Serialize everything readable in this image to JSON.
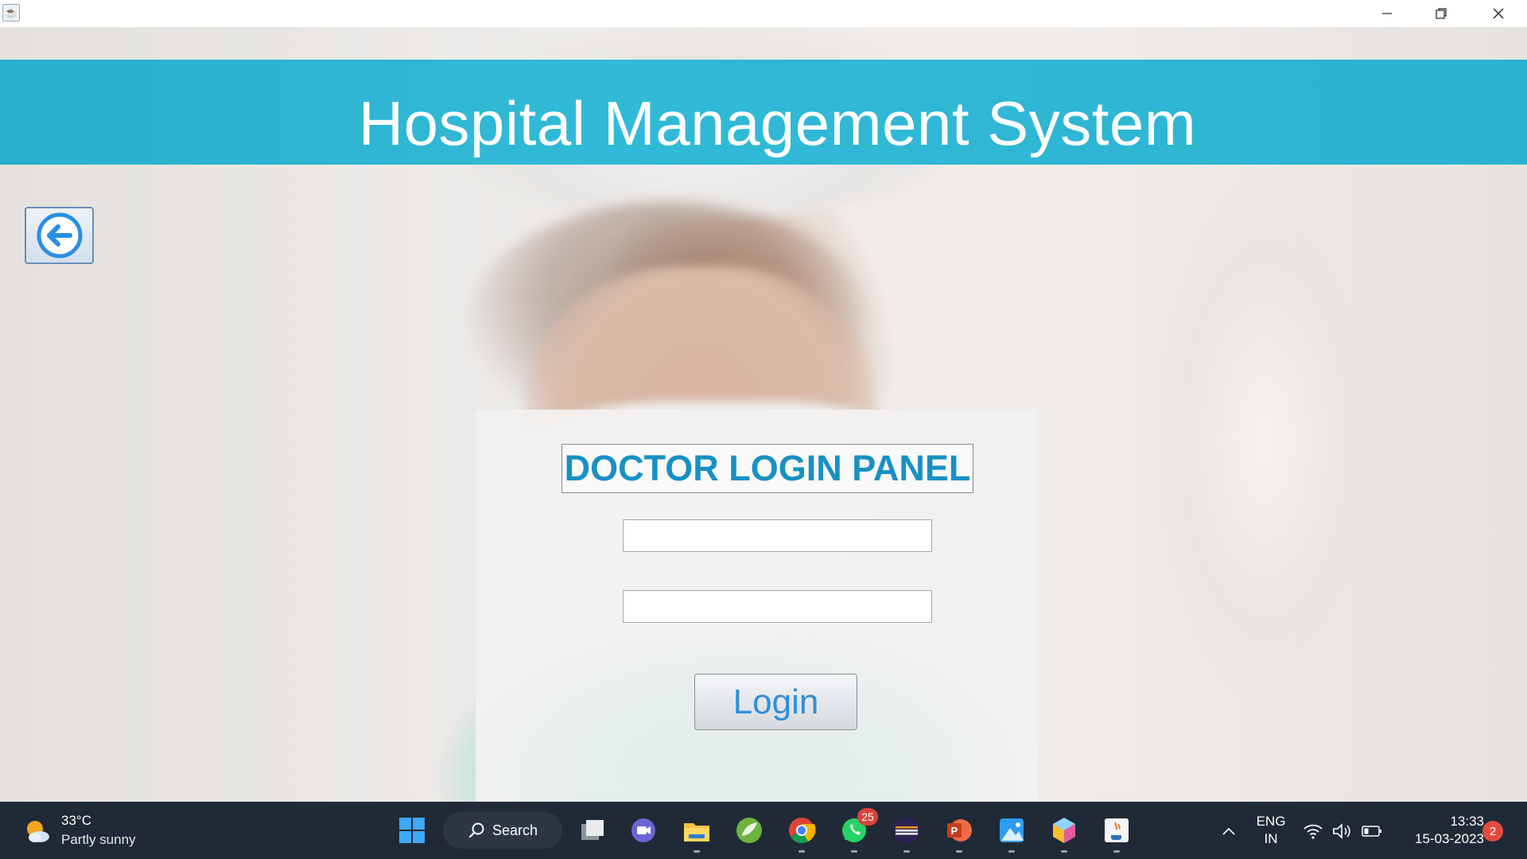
{
  "window": {
    "app_icon": "java-icon",
    "controls": [
      "minimize-icon",
      "restore-icon",
      "close-icon"
    ]
  },
  "header": {
    "title": "Hospital Management System"
  },
  "panel": {
    "title": "DOCTOR LOGIN PANEL",
    "username_value": "",
    "password_value": "",
    "login_label": "Login"
  },
  "taskbar": {
    "weather": {
      "temp": "33°C",
      "desc": "Partly sunny"
    },
    "search_label": "Search",
    "apps": [
      "windows-start-icon",
      "task-view-icon",
      "teams-meet-icon",
      "file-explorer-icon",
      "spring-icon",
      "chrome-icon",
      "whatsapp-icon",
      "eclipse-icon",
      "powerpoint-icon",
      "photos-icon",
      "netbeans-icon",
      "java-icon"
    ],
    "whatsapp_badge": "25",
    "lang_line1": "ENG",
    "lang_line2": "IN",
    "time": "13:33",
    "date": "15-03-2023",
    "notifications": "2"
  },
  "colors": {
    "banner": "#31bad7",
    "panel_title": "#1890c4",
    "login_text": "#2f8fd8",
    "taskbar": "#202a36"
  }
}
